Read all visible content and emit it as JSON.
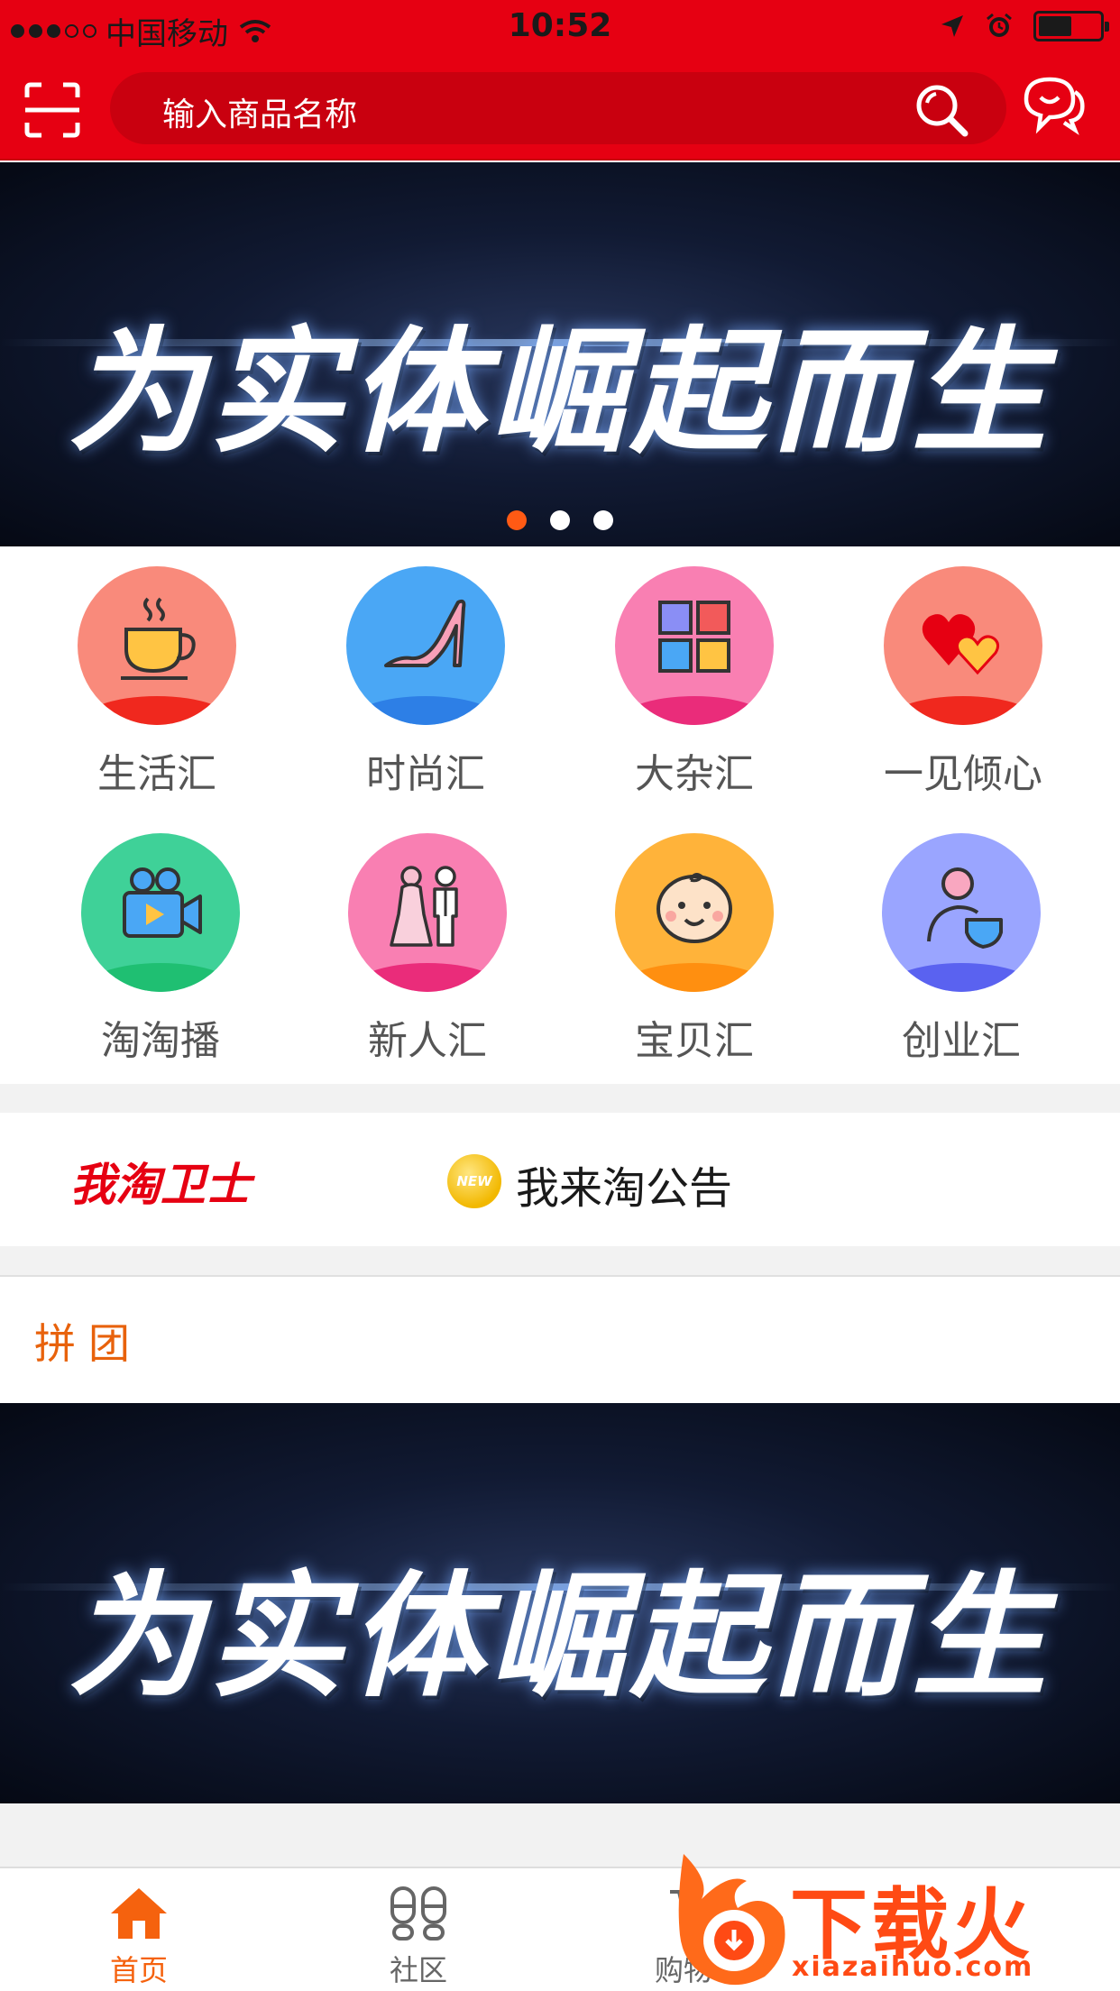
{
  "status_bar": {
    "carrier": "中国移动",
    "time": "10:52",
    "battery_level": 0.55
  },
  "header": {
    "search_placeholder": "输入商品名称",
    "icons": [
      "scan-icon",
      "search-icon",
      "message-icon"
    ]
  },
  "top_banner": {
    "text": "为实体崛起而生",
    "page_count": 3,
    "active_page": 0
  },
  "categories": [
    {
      "label": "生活汇",
      "icon": "coffee-cup-icon",
      "color": "#f98a7b",
      "band": "#f0281e"
    },
    {
      "label": "时尚汇",
      "icon": "high-heel-icon",
      "color": "#4aa7f5",
      "band": "#2d7fe6"
    },
    {
      "label": "大杂汇",
      "icon": "grid-icon",
      "color": "#f97fb2",
      "band": "#ea2c7a"
    },
    {
      "label": "一见倾心",
      "icon": "hearts-icon",
      "color": "#f98a7b",
      "band": "#f0281e"
    },
    {
      "label": "淘淘播",
      "icon": "video-camera-icon",
      "color": "#3fd198",
      "band": "#1fbf72"
    },
    {
      "label": "新人汇",
      "icon": "wedding-couple-icon",
      "color": "#f97fb2",
      "band": "#ea2c7a"
    },
    {
      "label": "宝贝汇",
      "icon": "baby-face-icon",
      "color": "#ffb33a",
      "band": "#ff8f10"
    },
    {
      "label": "创业汇",
      "icon": "entrepreneur-icon",
      "color": "#9aa5ff",
      "band": "#5a62f0"
    }
  ],
  "notice": {
    "brand": "我淘卫士",
    "badge": "NEW",
    "text": "我来淘公告"
  },
  "group_section": {
    "title": "拼团",
    "banner_text": "为实体崛起而生"
  },
  "tabbar": {
    "tabs": [
      {
        "label": "首页",
        "icon": "home-icon",
        "active": true
      },
      {
        "label": "社区",
        "icon": "footprints-icon",
        "active": false
      },
      {
        "label": "购物车",
        "icon": "cart-icon",
        "active": false
      }
    ],
    "active_color": "#f5620e",
    "inactive_color": "#666666"
  },
  "watermark": {
    "logo_text": "下载火",
    "url": "xiazaihuo.com"
  }
}
